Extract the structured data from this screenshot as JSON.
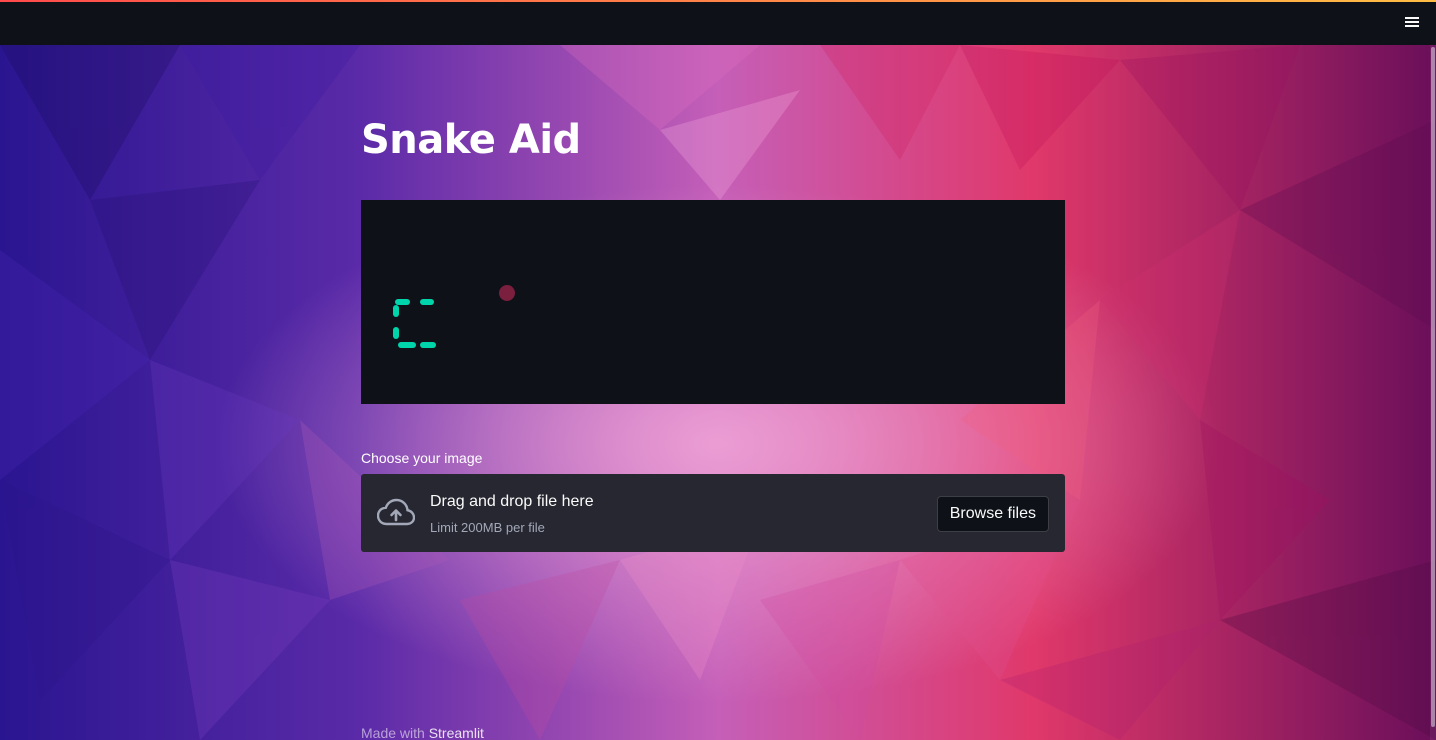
{
  "app": {
    "title": "Snake Aid"
  },
  "header": {
    "menu_icon": "hamburger-menu-icon",
    "accent_gradient": [
      "#ff4b4b",
      "#ffbd45"
    ]
  },
  "uploader": {
    "label": "Choose your image",
    "dropzone_title": "Drag and drop file here",
    "dropzone_subtitle": "Limit 200MB per file",
    "button_label": "Browse files",
    "icon": "cloud-upload-icon"
  },
  "footer": {
    "prefix": "Made with ",
    "link": "Streamlit"
  },
  "colors": {
    "header_bg": "#0e1117",
    "panel_bg": "#0e1117",
    "dropzone_bg": "#262730",
    "spinner": "#00d4aa",
    "dot": "#7a1f3d"
  }
}
